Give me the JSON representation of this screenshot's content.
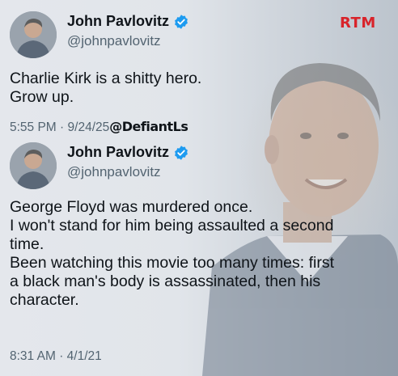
{
  "brand": {
    "logo_text": "RTM"
  },
  "tweets": [
    {
      "author": {
        "name": "John Pavlovitz",
        "handle": "@johnpavlovitz",
        "verified_icon": "verified-badge-icon"
      },
      "text": "Charlie Kirk is a shitty hero.\nGrow up.",
      "time": "5:55 PM",
      "separator": "·",
      "date": "9/24/25",
      "watermark": "@DefiantLs"
    },
    {
      "author": {
        "name": "John Pavlovitz",
        "handle": "@johnpavlovitz",
        "verified_icon": "verified-badge-icon"
      },
      "paragraphs": [
        "George Floyd was murdered once.",
        "I won't stand for him being assaulted a second\ntime.",
        "Been watching this movie too many times: first\na black man's body is assassinated, then his\ncharacter."
      ],
      "time": "8:31 AM",
      "separator": "·",
      "date": "4/1/21"
    }
  ],
  "colors": {
    "text": "#0f1419",
    "secondary": "#536471",
    "verified": "#1d9bf0",
    "brand": "#d8232a"
  }
}
